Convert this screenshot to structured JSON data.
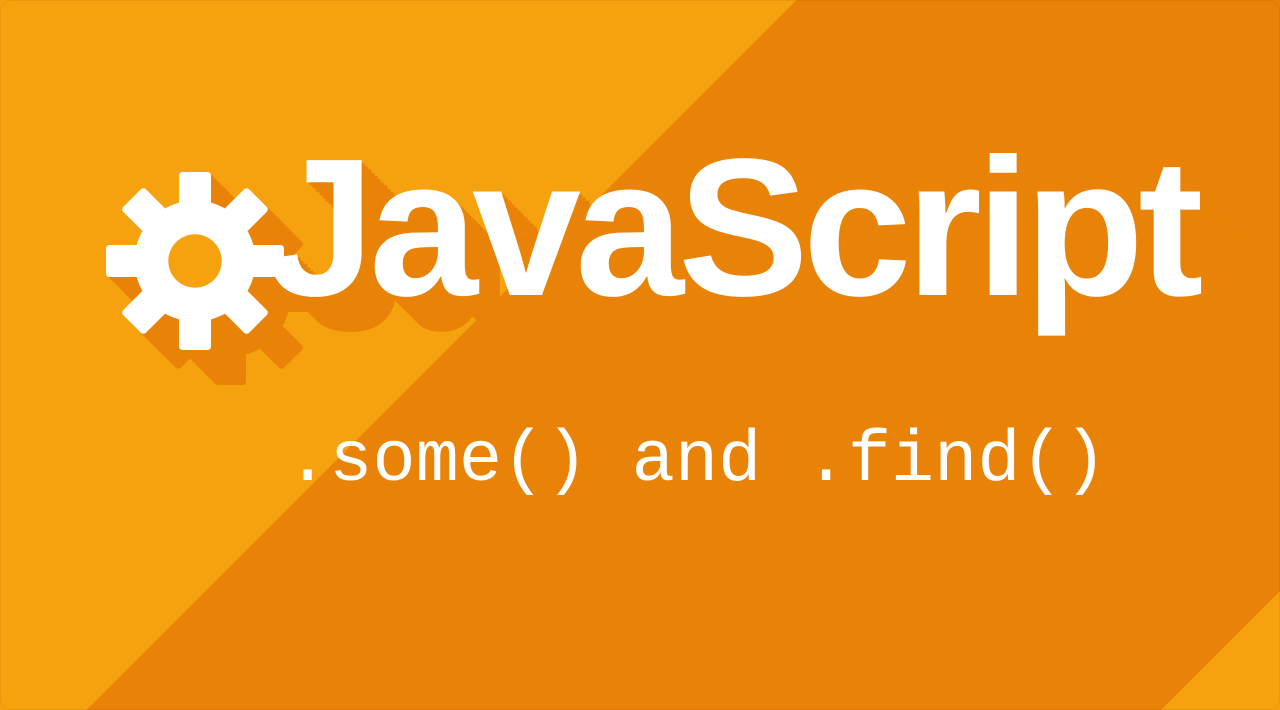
{
  "colors": {
    "bg": "#f6a20e",
    "shadow": "#e98307",
    "text": "#ffffff"
  },
  "hero": {
    "title": "JavaScript",
    "subtitle": ".some() and .find()",
    "icon": "gear-icon"
  }
}
